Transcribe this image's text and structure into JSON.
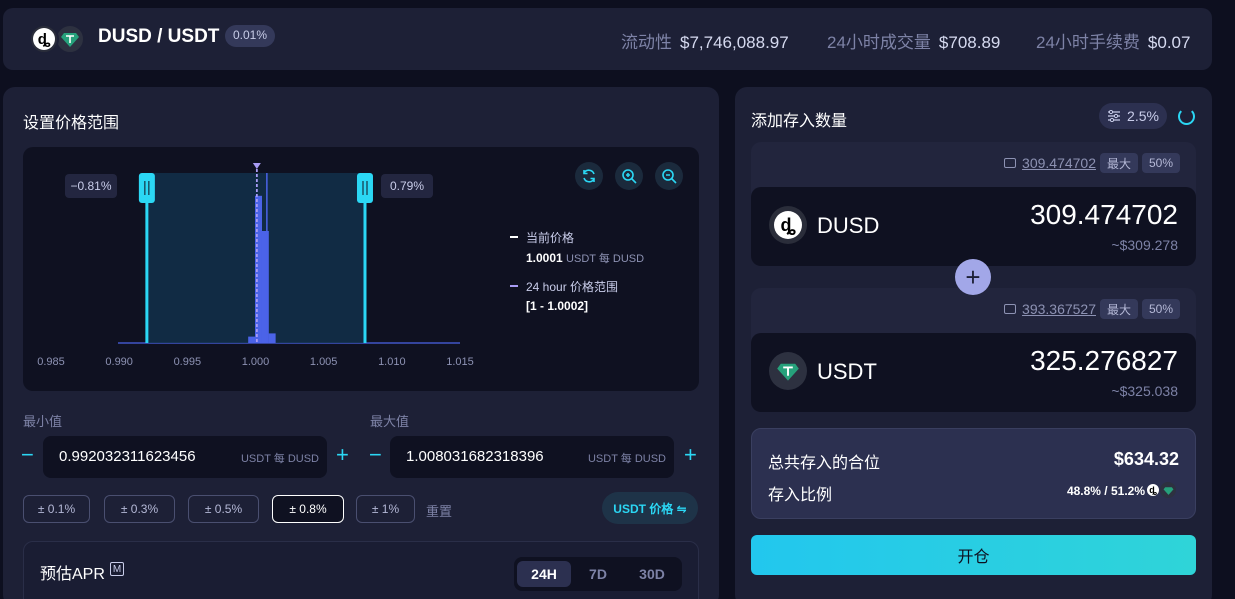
{
  "header": {
    "pair": "DUSD / USDT",
    "fee_tier": "0.01%",
    "stats": [
      {
        "label": "流动性",
        "value": "$7,746,088.97"
      },
      {
        "label": "24小时成交量",
        "value": "$708.89"
      },
      {
        "label": "24小时手续费",
        "value": "$0.07"
      }
    ]
  },
  "price_range": {
    "title": "设置价格范围",
    "left_pct": "−0.81%",
    "right_pct": "0.79%",
    "x_ticks": [
      "0.985",
      "0.990",
      "0.995",
      "1.000",
      "1.005",
      "1.010",
      "1.015"
    ],
    "legend": {
      "current_label": "当前价格",
      "current_value": "1.0001",
      "current_unit": "USDT 每 DUSD",
      "range_label": "24 hour 价格范围",
      "range_value": "[1 - 1.0002]"
    },
    "colors": {
      "handle": "#2bd7f4",
      "current_marker": "#a99cf5",
      "bars": "#4b63e8"
    },
    "icons": {
      "refresh": "refresh-icon",
      "zoom_in": "zoom-in-icon",
      "zoom_out": "zoom-out-icon"
    }
  },
  "chart_data": {
    "type": "bar",
    "x": [
      0.9995,
      1.0,
      1.0005,
      1.001
    ],
    "values": [
      2,
      46,
      35,
      3
    ],
    "xlim": [
      0.985,
      1.015
    ],
    "range_min": 0.992032,
    "range_max": 1.008031,
    "current_price": 1.0001
  },
  "inputs": {
    "min_label": "最小值",
    "max_label": "最大值",
    "min_value": "0.992032311623456",
    "max_value": "1.008031682318396",
    "unit": "USDT 每 DUSD",
    "minus": "−",
    "plus": "+"
  },
  "presets": [
    "± 0.1%",
    "± 0.3%",
    "± 0.5%",
    "± 0.8%",
    "± 1%"
  ],
  "active_preset": 3,
  "reset_label": "重置",
  "usdt_toggle": "USDT 价格 ⇋",
  "apr": {
    "title": "预估APR",
    "m_label": "M",
    "periods": [
      "24H",
      "7D",
      "30D"
    ],
    "active_period": 0
  },
  "deposit": {
    "title": "添加存入数量",
    "slippage": "2.5%",
    "max_label": "最大",
    "half_label": "50%",
    "tokens": [
      {
        "symbol": "DUSD",
        "balance": "309.474702",
        "amount": "309.474702",
        "usd": "~$309.278",
        "icon": "dusd-icon"
      },
      {
        "symbol": "USDT",
        "balance": "393.367527",
        "amount": "325.276827",
        "usd": "~$325.038",
        "icon": "usdt-icon"
      }
    ],
    "plus_label": "+",
    "total_label": "总共存入的合位",
    "total_value": "$634.32",
    "ratio_label": "存入比例",
    "ratio_value": "48.8% / 51.2%",
    "open_button": "开仓"
  }
}
